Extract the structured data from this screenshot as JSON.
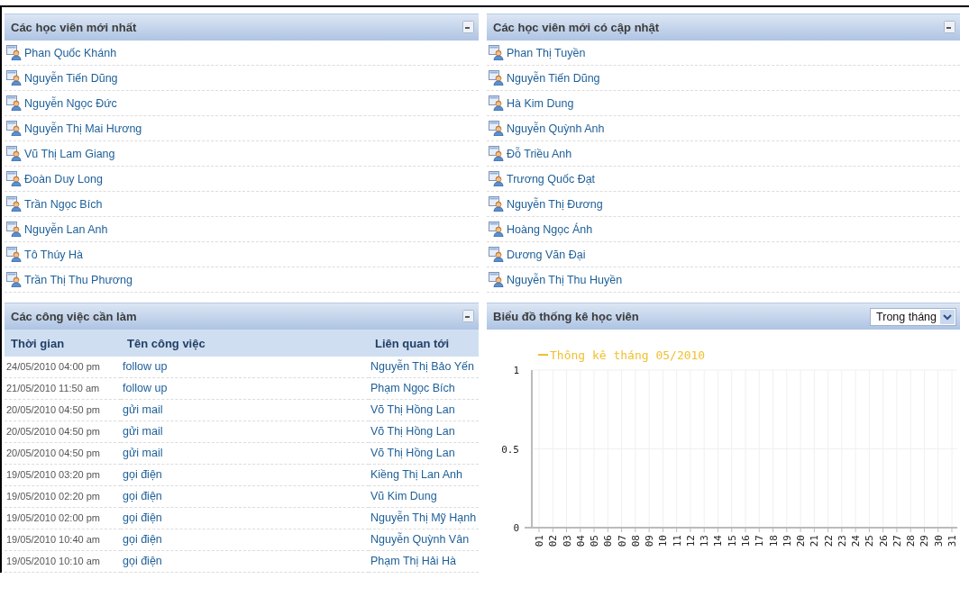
{
  "newest_students": {
    "title": "Các học viên mới nhất",
    "items": [
      "Phan Quốc Khánh",
      "Nguyễn Tiến Dũng",
      "Nguyễn Ngọc Đức",
      "Nguyễn Thị Mai Hương",
      "Vũ Thị Lam Giang",
      "Đoàn Duy Long",
      "Trần Ngọc Bích",
      "Nguyễn Lan Anh",
      "Tô Thúy Hà",
      "Trần Thị Thu Phương"
    ]
  },
  "updated_students": {
    "title": "Các học viên mới có cập nhật",
    "items": [
      "Phan Thị Tuyền",
      "Nguyễn Tiến Dũng",
      "Hà Kim Dung",
      "Nguyễn Quỳnh Anh",
      "Đỗ Triều Anh",
      "Trương Quốc Đạt",
      "Nguyễn Thị Đương",
      "Hoàng Ngọc Ánh",
      "Dương Văn Đại",
      "Nguyễn Thị Thu Huyền"
    ]
  },
  "tasks": {
    "title": "Các công việc cần làm",
    "columns": [
      "Thời gian",
      "Tên công việc",
      "Liên quan tới"
    ],
    "rows": [
      [
        "24/05/2010 04:00 pm",
        "follow up",
        "Nguyễn Thị Bảo Yến"
      ],
      [
        "21/05/2010 11:50 am",
        "follow up",
        "Phạm Ngọc Bích"
      ],
      [
        "20/05/2010 04:50 pm",
        "gửi mail",
        "Võ Thị Hồng Lan"
      ],
      [
        "20/05/2010 04:50 pm",
        "gửi mail",
        "Võ Thị Hồng Lan"
      ],
      [
        "20/05/2010 04:50 pm",
        "gửi mail",
        "Võ Thị Hồng Lan"
      ],
      [
        "19/05/2010 03:20 pm",
        "gọi điện",
        "Kiềng Thị Lan Anh"
      ],
      [
        "19/05/2010 02:20 pm",
        "gọi điện",
        "Vũ Kim Dung"
      ],
      [
        "19/05/2010 02:00 pm",
        "gọi điện",
        "Nguyễn Thị Mỹ Hạnh"
      ],
      [
        "19/05/2010 10:40 am",
        "gọi điện",
        "Nguyễn Quỳnh Vân"
      ],
      [
        "19/05/2010 10:10 am",
        "gọi điện",
        "Phạm Thị Hải Hà"
      ]
    ]
  },
  "chart_panel": {
    "title": "Biểu đồ thống kê học viên",
    "period_select": {
      "value": "Trong tháng"
    },
    "chart_data": {
      "type": "line",
      "categories": [
        "01",
        "02",
        "03",
        "04",
        "05",
        "06",
        "07",
        "08",
        "09",
        "10",
        "11",
        "12",
        "13",
        "14",
        "15",
        "16",
        "17",
        "18",
        "19",
        "20",
        "21",
        "22",
        "23",
        "24",
        "25",
        "26",
        "27",
        "28",
        "29",
        "30",
        "31"
      ],
      "ylim": [
        0,
        1
      ],
      "yticks": [
        0,
        0.5,
        1
      ],
      "series": [
        {
          "name": "Thông kê tháng 05/2010",
          "color": "#f0c030",
          "values": [
            null,
            null,
            null,
            null,
            null,
            null,
            null,
            null,
            null,
            null,
            null,
            null,
            null,
            null,
            null,
            null,
            null,
            null,
            null,
            null,
            null,
            null,
            null,
            null,
            null,
            null,
            null,
            null,
            null,
            null,
            null
          ]
        }
      ],
      "grid": true
    }
  }
}
